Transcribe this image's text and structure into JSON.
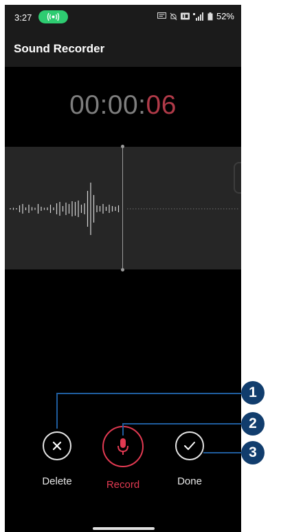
{
  "status_bar": {
    "time": "3:27",
    "battery": "52%"
  },
  "app_bar": {
    "title": "Sound Recorder"
  },
  "timer": {
    "base": "00:00:",
    "seconds": "06"
  },
  "controls": {
    "delete_label": "Delete",
    "record_label": "Record",
    "done_label": "Done"
  },
  "callouts": [
    "1",
    "2",
    "3"
  ],
  "colors": {
    "accent": "#e23a52",
    "background": "#000000",
    "panel": "#262626",
    "callout": "#113d6d"
  }
}
